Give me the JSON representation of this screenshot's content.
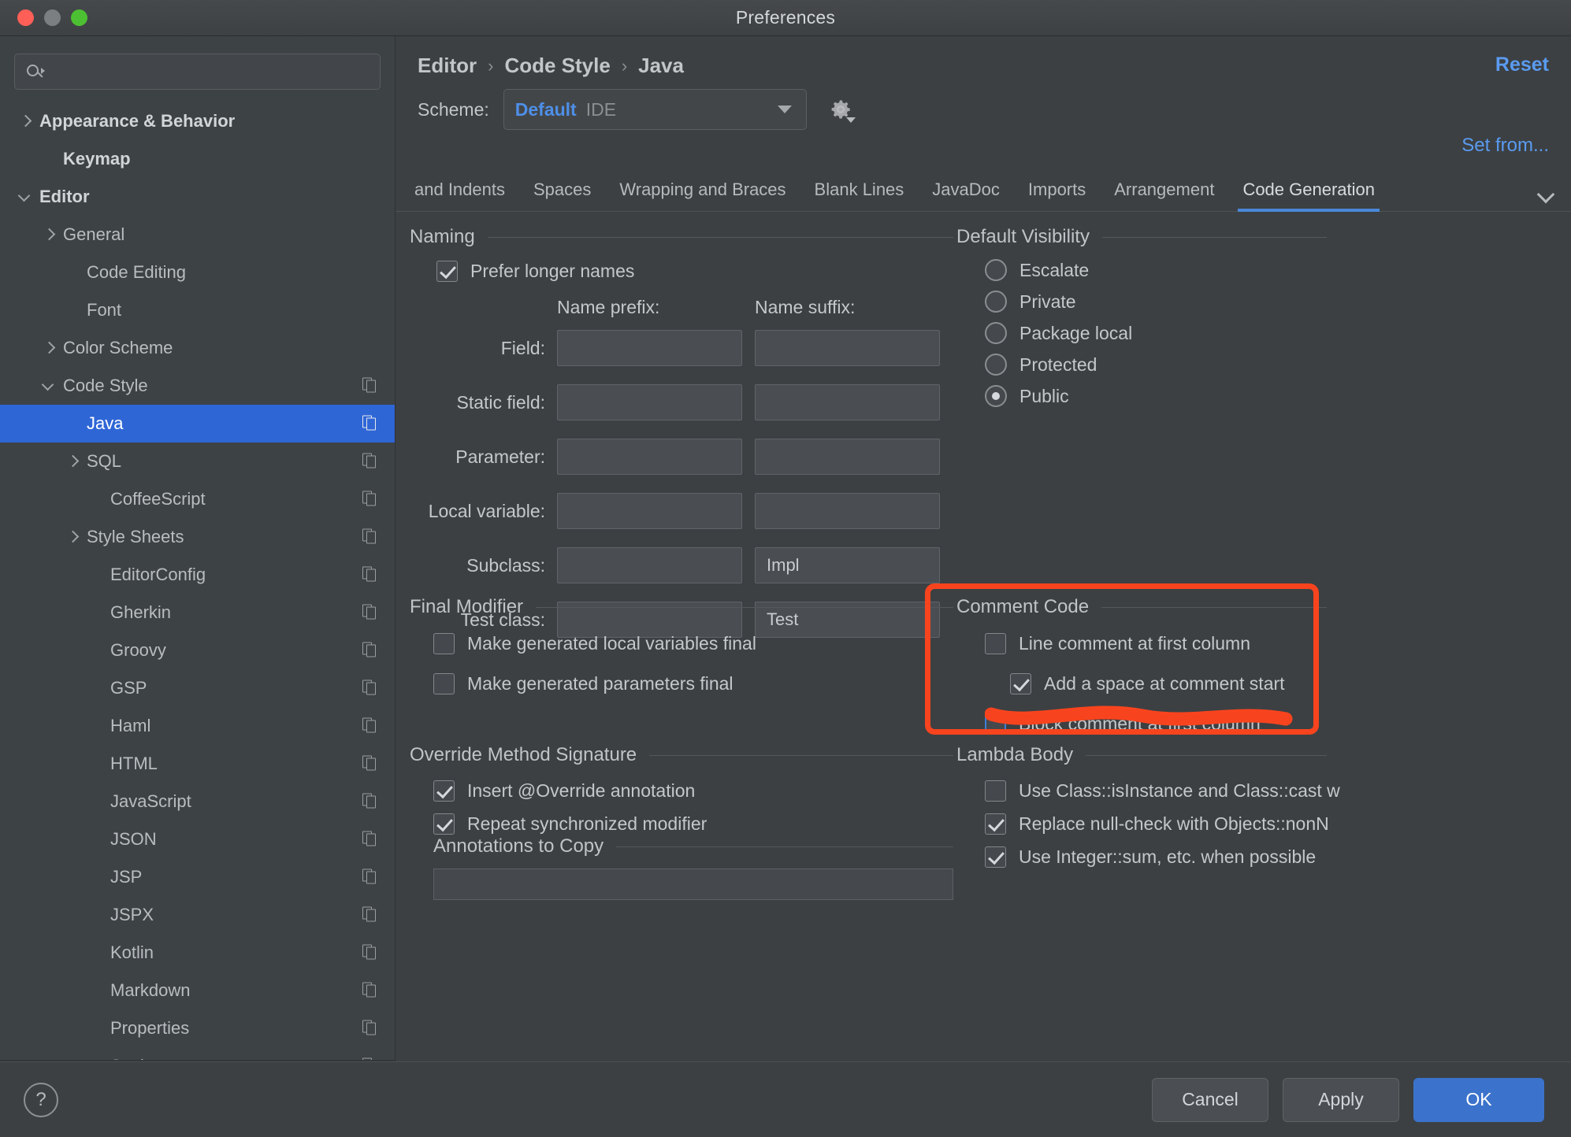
{
  "window": {
    "title": "Preferences"
  },
  "search": {
    "placeholder": "",
    "value": ""
  },
  "sidebar": {
    "items": [
      {
        "label": "Appearance & Behavior",
        "indent": 0,
        "arrow": "right",
        "bold": true,
        "copy": false,
        "selected": false
      },
      {
        "label": "Keymap",
        "indent": 1,
        "arrow": "none",
        "bold": true,
        "copy": false,
        "selected": false
      },
      {
        "label": "Editor",
        "indent": 0,
        "arrow": "down",
        "bold": true,
        "copy": false,
        "selected": false
      },
      {
        "label": "General",
        "indent": 1,
        "arrow": "right",
        "bold": false,
        "copy": false,
        "selected": false
      },
      {
        "label": "Code Editing",
        "indent": 2,
        "arrow": "none",
        "bold": false,
        "copy": false,
        "selected": false
      },
      {
        "label": "Font",
        "indent": 2,
        "arrow": "none",
        "bold": false,
        "copy": false,
        "selected": false
      },
      {
        "label": "Color Scheme",
        "indent": 1,
        "arrow": "right",
        "bold": false,
        "copy": false,
        "selected": false
      },
      {
        "label": "Code Style",
        "indent": 1,
        "arrow": "down",
        "bold": false,
        "copy": true,
        "selected": false
      },
      {
        "label": "Java",
        "indent": 2,
        "arrow": "none",
        "bold": false,
        "copy": true,
        "selected": true
      },
      {
        "label": "SQL",
        "indent": 2,
        "arrow": "right",
        "bold": false,
        "copy": true,
        "selected": false
      },
      {
        "label": "CoffeeScript",
        "indent": 3,
        "arrow": "none",
        "bold": false,
        "copy": true,
        "selected": false
      },
      {
        "label": "Style Sheets",
        "indent": 2,
        "arrow": "right",
        "bold": false,
        "copy": true,
        "selected": false
      },
      {
        "label": "EditorConfig",
        "indent": 3,
        "arrow": "none",
        "bold": false,
        "copy": true,
        "selected": false
      },
      {
        "label": "Gherkin",
        "indent": 3,
        "arrow": "none",
        "bold": false,
        "copy": true,
        "selected": false
      },
      {
        "label": "Groovy",
        "indent": 3,
        "arrow": "none",
        "bold": false,
        "copy": true,
        "selected": false
      },
      {
        "label": "GSP",
        "indent": 3,
        "arrow": "none",
        "bold": false,
        "copy": true,
        "selected": false
      },
      {
        "label": "Haml",
        "indent": 3,
        "arrow": "none",
        "bold": false,
        "copy": true,
        "selected": false
      },
      {
        "label": "HTML",
        "indent": 3,
        "arrow": "none",
        "bold": false,
        "copy": true,
        "selected": false
      },
      {
        "label": "JavaScript",
        "indent": 3,
        "arrow": "none",
        "bold": false,
        "copy": true,
        "selected": false
      },
      {
        "label": "JSON",
        "indent": 3,
        "arrow": "none",
        "bold": false,
        "copy": true,
        "selected": false
      },
      {
        "label": "JSP",
        "indent": 3,
        "arrow": "none",
        "bold": false,
        "copy": true,
        "selected": false
      },
      {
        "label": "JSPX",
        "indent": 3,
        "arrow": "none",
        "bold": false,
        "copy": true,
        "selected": false
      },
      {
        "label": "Kotlin",
        "indent": 3,
        "arrow": "none",
        "bold": false,
        "copy": true,
        "selected": false
      },
      {
        "label": "Markdown",
        "indent": 3,
        "arrow": "none",
        "bold": false,
        "copy": true,
        "selected": false
      },
      {
        "label": "Properties",
        "indent": 3,
        "arrow": "none",
        "bold": false,
        "copy": true,
        "selected": false
      },
      {
        "label": "Scala",
        "indent": 3,
        "arrow": "none",
        "bold": false,
        "copy": true,
        "selected": false
      }
    ]
  },
  "header": {
    "breadcrumb": [
      "Editor",
      "Code Style",
      "Java"
    ],
    "separator": "›",
    "reset_label": "Reset",
    "scheme_label": "Scheme:",
    "scheme_value": "Default",
    "scheme_scope": "IDE",
    "set_from_label": "Set from..."
  },
  "tabs": {
    "items": [
      {
        "label": "and Indents",
        "active": false,
        "clipped": true
      },
      {
        "label": "Spaces",
        "active": false
      },
      {
        "label": "Wrapping and Braces",
        "active": false
      },
      {
        "label": "Blank Lines",
        "active": false
      },
      {
        "label": "JavaDoc",
        "active": false
      },
      {
        "label": "Imports",
        "active": false
      },
      {
        "label": "Arrangement",
        "active": false
      },
      {
        "label": "Code Generation",
        "active": true
      }
    ]
  },
  "naming": {
    "title": "Naming",
    "prefer_longer_names": {
      "label": "Prefer longer names",
      "checked": true
    },
    "col_prefix": "Name prefix:",
    "col_suffix": "Name suffix:",
    "rows": [
      {
        "label": "Field:",
        "prefix": "",
        "suffix": ""
      },
      {
        "label": "Static field:",
        "prefix": "",
        "suffix": ""
      },
      {
        "label": "Parameter:",
        "prefix": "",
        "suffix": ""
      },
      {
        "label": "Local variable:",
        "prefix": "",
        "suffix": ""
      },
      {
        "label": "Subclass:",
        "prefix": "",
        "suffix": "Impl"
      },
      {
        "label": "Test class:",
        "prefix": "",
        "suffix": "Test"
      }
    ]
  },
  "default_visibility": {
    "title": "Default Visibility",
    "options": [
      {
        "label": "Escalate",
        "selected": false
      },
      {
        "label": "Private",
        "selected": false
      },
      {
        "label": "Package local",
        "selected": false
      },
      {
        "label": "Protected",
        "selected": false
      },
      {
        "label": "Public",
        "selected": true
      }
    ]
  },
  "final_modifier": {
    "title": "Final Modifier",
    "options": [
      {
        "label": "Make generated local variables final",
        "checked": false
      },
      {
        "label": "Make generated parameters final",
        "checked": false
      }
    ]
  },
  "comment_code": {
    "title": "Comment Code",
    "options": [
      {
        "label": "Line comment at first column",
        "checked": false,
        "indent": 0,
        "focused": false
      },
      {
        "label": "Add a space at comment start",
        "checked": true,
        "indent": 1,
        "focused": false
      },
      {
        "label": "Block comment at first column",
        "checked": false,
        "indent": 0,
        "focused": true
      }
    ]
  },
  "override_method_signature": {
    "title": "Override Method Signature",
    "options": [
      {
        "label": "Insert @Override annotation",
        "checked": true
      },
      {
        "label": "Repeat synchronized modifier",
        "checked": true
      }
    ],
    "annotations_label": "Annotations to Copy"
  },
  "lambda_body": {
    "title": "Lambda Body",
    "options": [
      {
        "label": "Use Class::isInstance and Class::cast w",
        "checked": false
      },
      {
        "label": "Replace null-check with Objects::nonN",
        "checked": true
      },
      {
        "label": "Use Integer::sum, etc. when possible",
        "checked": true
      }
    ]
  },
  "footer": {
    "help_label": "?",
    "cancel_label": "Cancel",
    "apply_label": "Apply",
    "ok_label": "OK"
  },
  "annotation": {
    "accent_color": "#f8441e"
  }
}
